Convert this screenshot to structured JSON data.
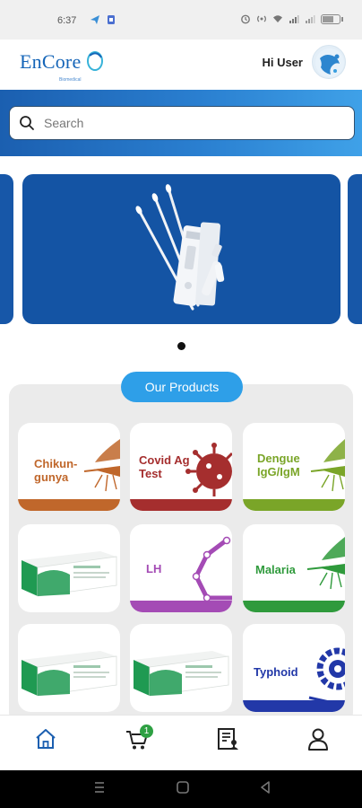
{
  "status_bar": {
    "time": "6:37"
  },
  "header": {
    "logo_text": "EnCore",
    "logo_subtitle": "Biomedical",
    "greeting": "Hi User"
  },
  "search": {
    "placeholder": "Search"
  },
  "carousel": {
    "slide_count": 1,
    "active_index": 0
  },
  "products": {
    "section_title": "Our Products",
    "items": [
      {
        "label": "Chikun-\ngunya",
        "color": "#c0672b"
      },
      {
        "label": "Covid Ag\nTest",
        "color": "#a52e2e"
      },
      {
        "label": "Dengue\nIgG/IgM",
        "color": "#7aa528"
      },
      {
        "label": "",
        "color": "#1f9a52"
      },
      {
        "label": "LH",
        "color": "#a44bb5"
      },
      {
        "label": "Malaria",
        "color": "#2f9a3c"
      },
      {
        "label": "",
        "color": "#1f9a52"
      },
      {
        "label": "",
        "color": "#1f9a52"
      },
      {
        "label": "Typhoid",
        "color": "#2238a8"
      }
    ]
  },
  "bottom_nav": {
    "items": [
      {
        "icon": "home-icon",
        "active": true
      },
      {
        "icon": "cart-icon",
        "badge": "1"
      },
      {
        "icon": "orders-icon"
      },
      {
        "icon": "profile-icon"
      }
    ]
  },
  "colors": {
    "brand_blue": "#1565b8",
    "accent_pill": "#2e9fe8",
    "banner_blue": "#1454a4"
  }
}
